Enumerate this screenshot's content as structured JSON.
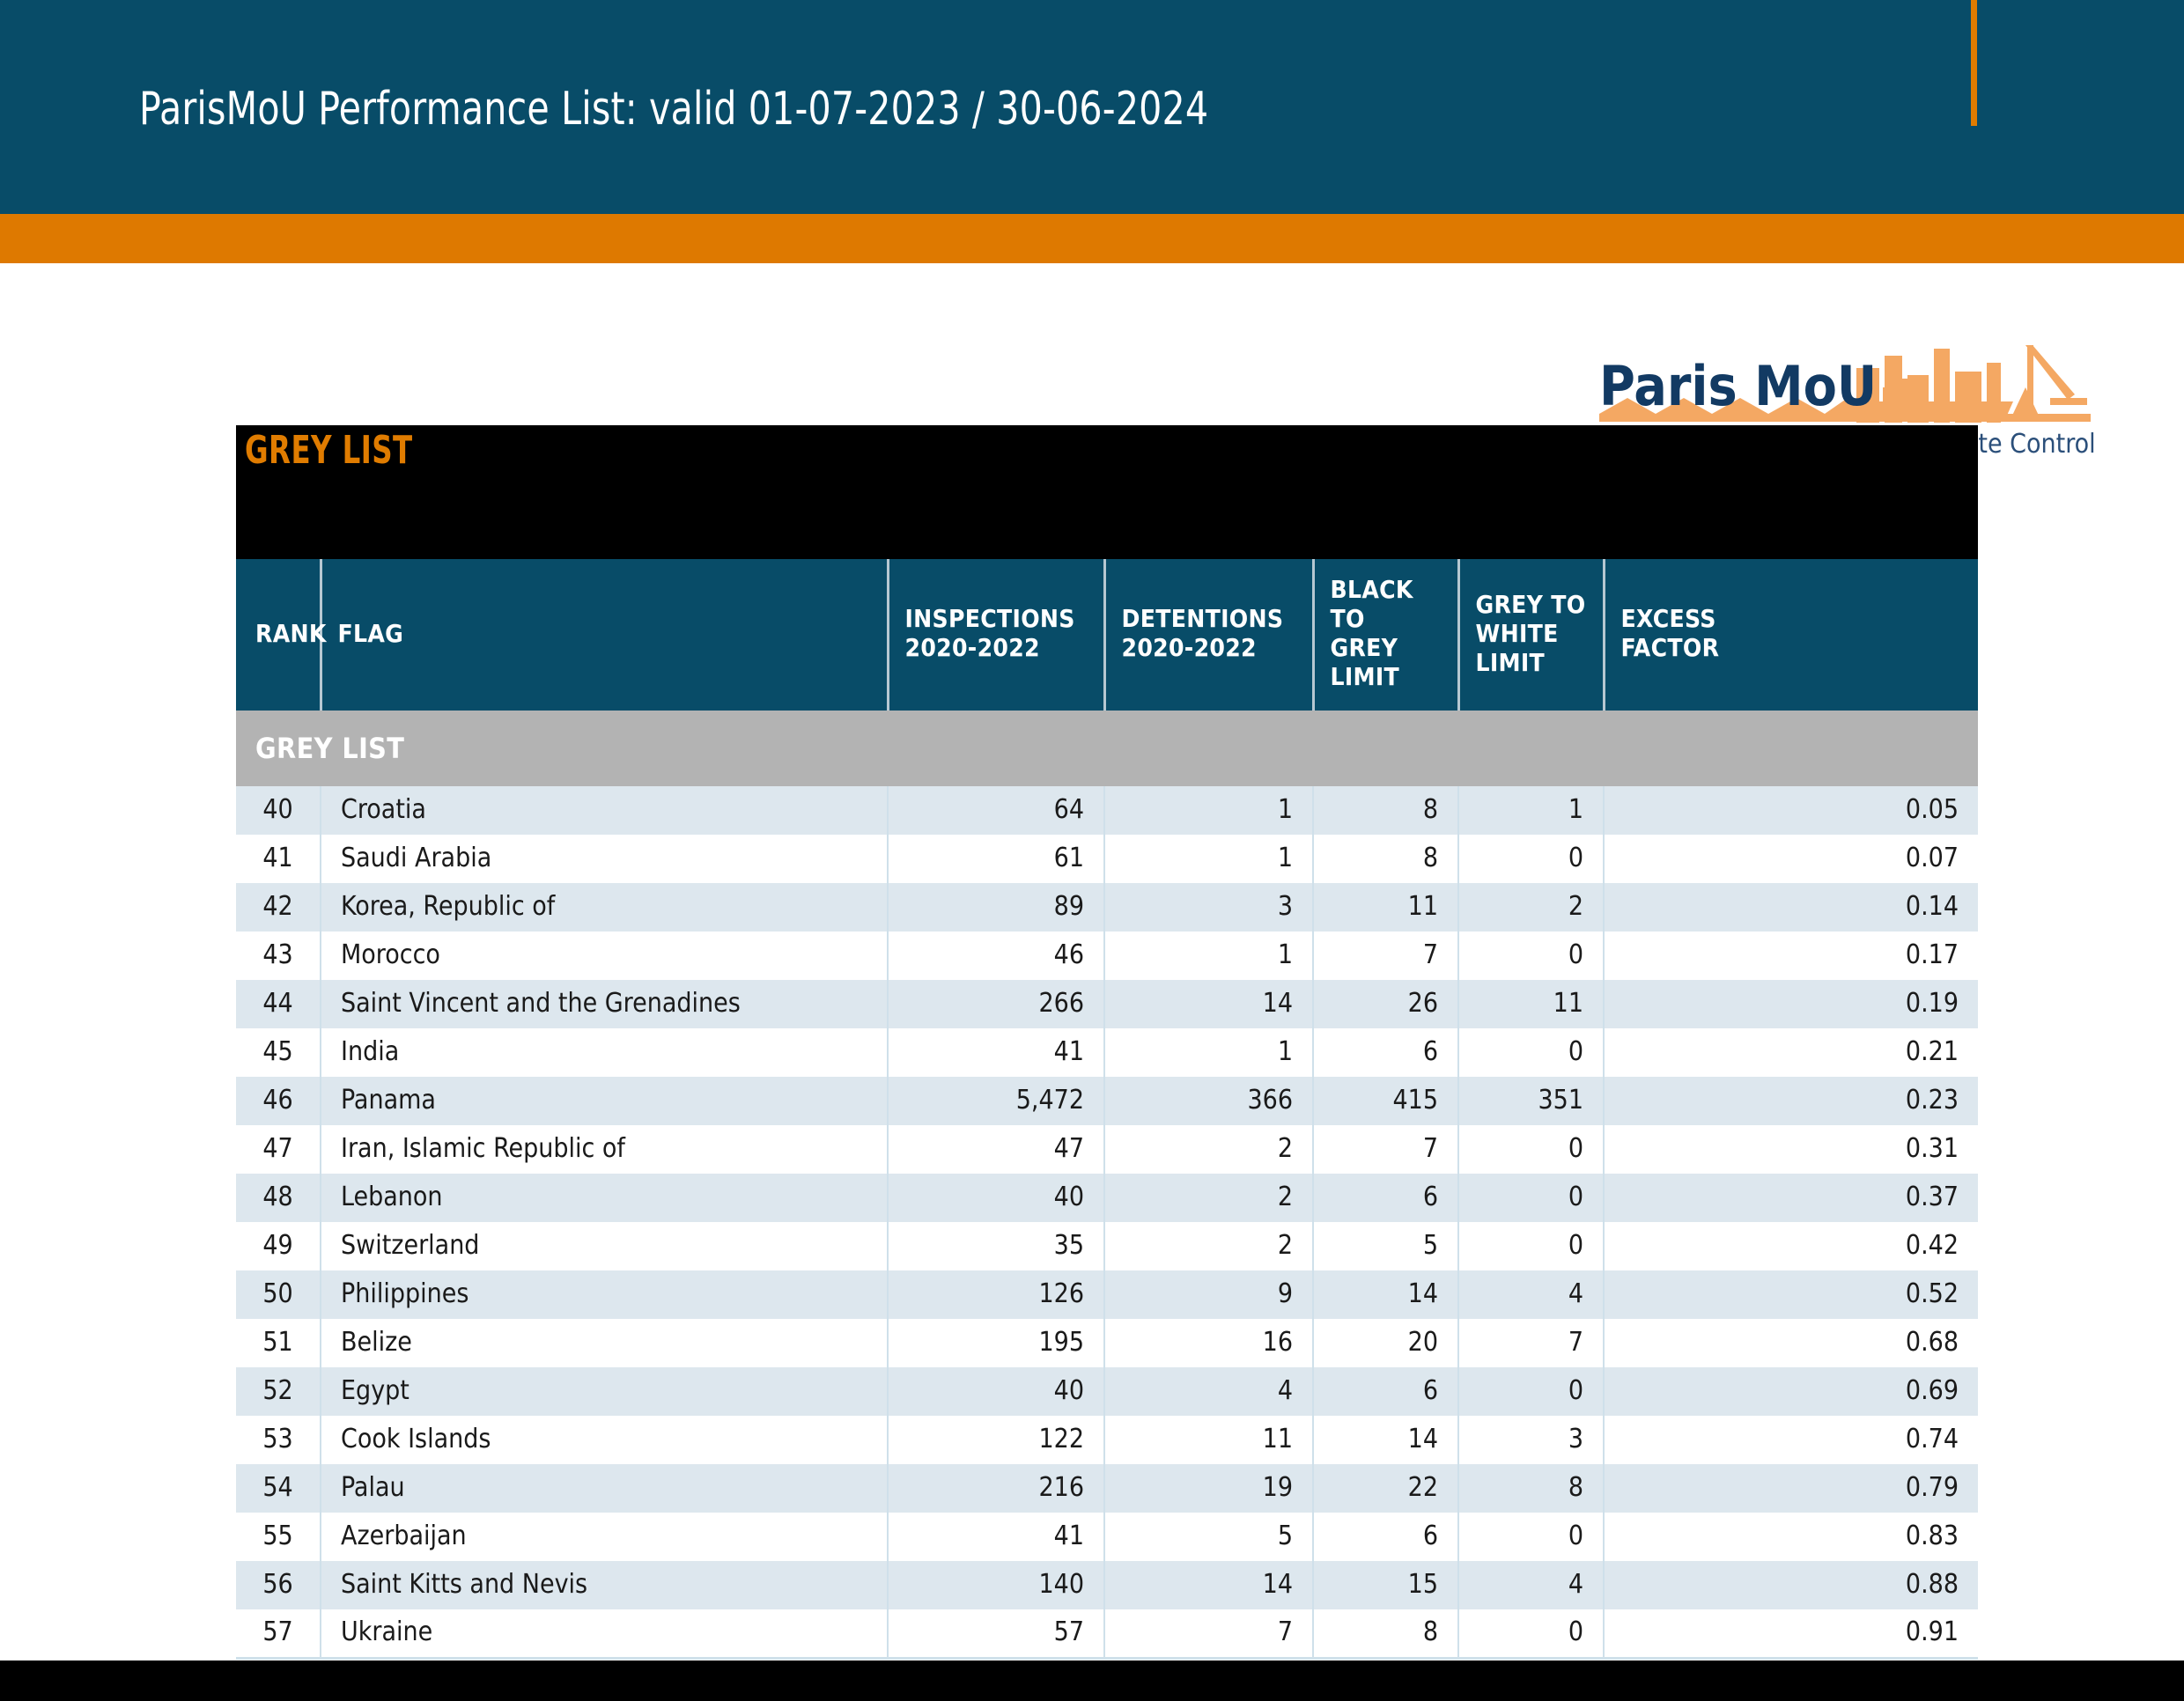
{
  "header": {
    "title": "ParisMoU Performance List: valid 01-07-2023 / 30-06-2024",
    "accent_color": "#de7900",
    "background_color": "#084c68"
  },
  "logo": {
    "name_primary": "Paris MoU",
    "name_secondary": "on Port State Control",
    "navy": "#123a63",
    "orange": "#f4a863"
  },
  "title_band": {
    "label": "GREY LIST",
    "text_color": "#e07c00",
    "background_color": "#000000"
  },
  "table": {
    "columns": [
      {
        "key": "rank",
        "label": "RANK"
      },
      {
        "key": "flag",
        "label": "FLAG"
      },
      {
        "key": "insp",
        "label": "INSPECTIONS 2020-2022"
      },
      {
        "key": "det",
        "label": "DETENTIONS 2020-2022"
      },
      {
        "key": "blackgrey",
        "label": "BLACK TO GREY LIMIT"
      },
      {
        "key": "greywhite",
        "label": "GREY TO WHITE LIMIT"
      },
      {
        "key": "excess",
        "label": "EXCESS FACTOR"
      }
    ],
    "header_labels_multiline": {
      "rank": [
        "RANK"
      ],
      "flag": [
        "FLAG"
      ],
      "insp": [
        "INSPECTIONS",
        "2020-2022"
      ],
      "det": [
        "DETENTIONS",
        "2020-2022"
      ],
      "blackgrey": [
        "BLACK TO",
        "GREY LIMIT"
      ],
      "greywhite": [
        "GREY TO",
        "WHITE LIMIT"
      ],
      "excess": [
        "EXCESS",
        "FACTOR"
      ]
    },
    "section_label": "GREY LIST",
    "rows": [
      {
        "rank": "40",
        "flag": "Croatia",
        "insp": "64",
        "det": "1",
        "blackgrey": "8",
        "greywhite": "1",
        "excess": "0.05"
      },
      {
        "rank": "41",
        "flag": "Saudi Arabia",
        "insp": "61",
        "det": "1",
        "blackgrey": "8",
        "greywhite": "0",
        "excess": "0.07"
      },
      {
        "rank": "42",
        "flag": "Korea, Republic of",
        "insp": "89",
        "det": "3",
        "blackgrey": "11",
        "greywhite": "2",
        "excess": "0.14"
      },
      {
        "rank": "43",
        "flag": "Morocco",
        "insp": "46",
        "det": "1",
        "blackgrey": "7",
        "greywhite": "0",
        "excess": "0.17"
      },
      {
        "rank": "44",
        "flag": "Saint Vincent and the Grenadines",
        "insp": "266",
        "det": "14",
        "blackgrey": "26",
        "greywhite": "11",
        "excess": "0.19"
      },
      {
        "rank": "45",
        "flag": "India",
        "insp": "41",
        "det": "1",
        "blackgrey": "6",
        "greywhite": "0",
        "excess": "0.21"
      },
      {
        "rank": "46",
        "flag": "Panama",
        "insp": "5,472",
        "det": "366",
        "blackgrey": "415",
        "greywhite": "351",
        "excess": "0.23"
      },
      {
        "rank": "47",
        "flag": "Iran, Islamic Republic of",
        "insp": "47",
        "det": "2",
        "blackgrey": "7",
        "greywhite": "0",
        "excess": "0.31"
      },
      {
        "rank": "48",
        "flag": "Lebanon",
        "insp": "40",
        "det": "2",
        "blackgrey": "6",
        "greywhite": "0",
        "excess": "0.37"
      },
      {
        "rank": "49",
        "flag": "Switzerland",
        "insp": "35",
        "det": "2",
        "blackgrey": "5",
        "greywhite": "0",
        "excess": "0.42"
      },
      {
        "rank": "50",
        "flag": "Philippines",
        "insp": "126",
        "det": "9",
        "blackgrey": "14",
        "greywhite": "4",
        "excess": "0.52"
      },
      {
        "rank": "51",
        "flag": "Belize",
        "insp": "195",
        "det": "16",
        "blackgrey": "20",
        "greywhite": "7",
        "excess": "0.68"
      },
      {
        "rank": "52",
        "flag": "Egypt",
        "insp": "40",
        "det": "4",
        "blackgrey": "6",
        "greywhite": "0",
        "excess": "0.69"
      },
      {
        "rank": "53",
        "flag": "Cook Islands",
        "insp": "122",
        "det": "11",
        "blackgrey": "14",
        "greywhite": "3",
        "excess": "0.74"
      },
      {
        "rank": "54",
        "flag": "Palau",
        "insp": "216",
        "det": "19",
        "blackgrey": "22",
        "greywhite": "8",
        "excess": "0.79"
      },
      {
        "rank": "55",
        "flag": "Azerbaijan",
        "insp": "41",
        "det": "5",
        "blackgrey": "6",
        "greywhite": "0",
        "excess": "0.83"
      },
      {
        "rank": "56",
        "flag": "Saint Kitts and Nevis",
        "insp": "140",
        "det": "14",
        "blackgrey": "15",
        "greywhite": "4",
        "excess": "0.88"
      },
      {
        "rank": "57",
        "flag": "Ukraine",
        "insp": "57",
        "det": "7",
        "blackgrey": "8",
        "greywhite": "0",
        "excess": "0.91"
      }
    ]
  }
}
